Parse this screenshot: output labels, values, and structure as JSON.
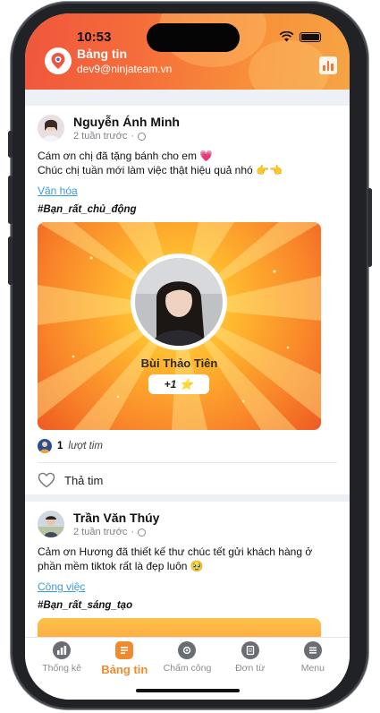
{
  "status_bar": {
    "time": "10:53"
  },
  "header": {
    "title": "Bảng tin",
    "subtitle": "dev9@ninjateam.vn",
    "logo_icon": "location-pin-icon",
    "stats_icon": "bar-chart-icon"
  },
  "posts": [
    {
      "author": "Nguyễn Ánh Minh",
      "time": "2 tuần trước",
      "message": "Cám ơn chị đã tặng bánh cho em 💗\nChúc chị tuần mới làm việc thật hiệu quả nhó 👉👈",
      "topic": "Văn hóa",
      "tag": "#Bạn_rất_chủ_động",
      "recipient": {
        "name": "Bùi Thảo Tiên",
        "points": "+1",
        "star": "⭐"
      },
      "likes": {
        "count": "1",
        "label": "lượt tim"
      },
      "like_action": "Thả tim"
    },
    {
      "author": "Trần Văn Thúy",
      "time": "2 tuần trước",
      "message": "Cảm ơn Hương đã thiết kế thư chúc tết gửi khách hàng ở phần mềm tiktok rất là đẹp luôn 🥹",
      "topic": "Công việc",
      "tag": "#Bạn_rất_sáng_tạo"
    }
  ],
  "tabs": [
    {
      "label": "Thống kê",
      "icon": "stats-icon",
      "active": false
    },
    {
      "label": "Bảng tin",
      "icon": "news-icon",
      "active": true
    },
    {
      "label": "Chấm công",
      "icon": "camera-icon",
      "active": false
    },
    {
      "label": "Đơn từ",
      "icon": "document-icon",
      "active": false
    },
    {
      "label": "Menu",
      "icon": "menu-icon",
      "active": false
    }
  ],
  "colors": {
    "accent": "#f08a2e",
    "header_start": "#f0563d",
    "header_end": "#f5a444",
    "link": "#3a9ae0"
  }
}
